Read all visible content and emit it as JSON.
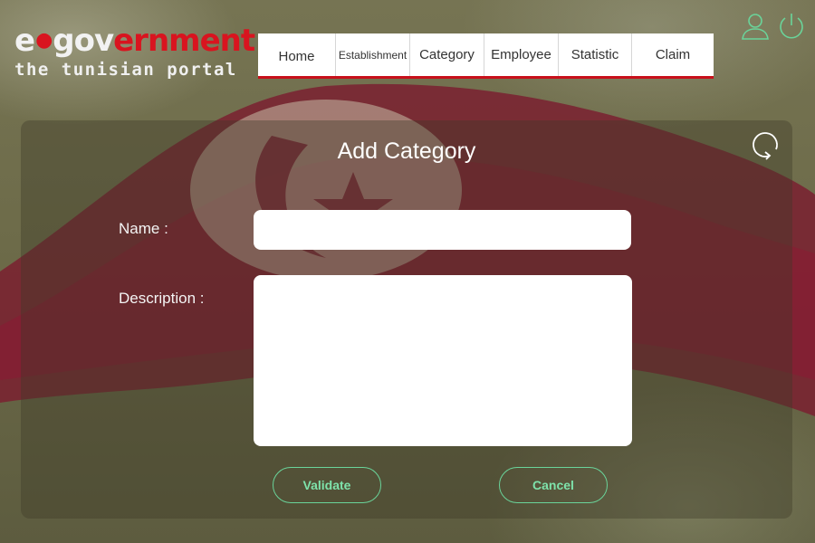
{
  "logo": {
    "line1_white": "e",
    "line1_dot": "●",
    "line1_gov": "gov",
    "line1_red": "ernment",
    "line2": "the tunisian portal"
  },
  "nav": {
    "items": [
      "Home",
      "Establishment",
      "Category",
      "Employee",
      "Statistic",
      "Claim"
    ]
  },
  "header_icons": [
    "user-icon",
    "power-icon"
  ],
  "form": {
    "title": "Add Category",
    "name_label": "Name :",
    "name_value": "",
    "description_label": "Description :",
    "description_value": "",
    "validate_label": "Validate",
    "cancel_label": "Cancel",
    "refresh_icon": "refresh-icon"
  },
  "colors": {
    "flag_red": "#c8101b",
    "accent_green": "#6ad49a",
    "nav_underline": "#c8101b"
  }
}
